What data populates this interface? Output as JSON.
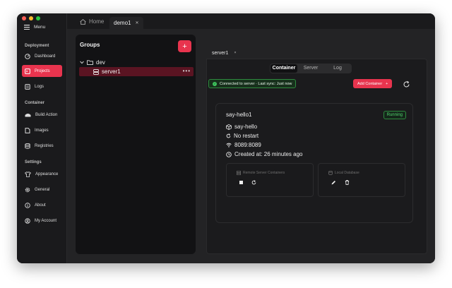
{
  "sidebar": {
    "menu_label": "Menu",
    "sections": {
      "deployment": "Deployment",
      "container": "Container",
      "settings": "Settings"
    },
    "items": [
      {
        "label": "Dashboard",
        "icon": "dashboard-icon"
      },
      {
        "label": "Projects",
        "icon": "projects-icon",
        "active": true
      },
      {
        "label": "Logs",
        "icon": "logs-icon"
      },
      {
        "label": "Build Action",
        "icon": "build-action-icon"
      },
      {
        "label": "Images",
        "icon": "images-icon"
      },
      {
        "label": "Registries",
        "icon": "registries-icon"
      },
      {
        "label": "Appearance",
        "icon": "appearance-icon"
      },
      {
        "label": "General",
        "icon": "gear-icon"
      },
      {
        "label": "About",
        "icon": "info-icon"
      },
      {
        "label": "My Account",
        "icon": "account-icon"
      }
    ]
  },
  "tabs": {
    "home": "Home",
    "current": "demo1"
  },
  "groups": {
    "title": "Groups",
    "add_label": "+",
    "tree": {
      "folder": "dev",
      "server": "server1",
      "more_label": "•••"
    }
  },
  "server_tab": {
    "label": "server1",
    "close": "×"
  },
  "segment": {
    "options": [
      "Container",
      "Server",
      "Log"
    ],
    "active": "Container"
  },
  "status": {
    "text": "Connected to server · Last sync: Just now"
  },
  "add_container": {
    "label": "Add Container",
    "plus": "+"
  },
  "container_card": {
    "title": "say-hello1",
    "status": "Running",
    "image": "say-hello",
    "restart": "No restart",
    "ports": "8089:8089",
    "created": "Created at: 26 minutes ago",
    "remote_title": "Remote Server Containers",
    "local_title": "Local Database"
  },
  "colors": {
    "accent": "#e8344e",
    "success": "#3ec25c",
    "background": "#1e1e20"
  }
}
